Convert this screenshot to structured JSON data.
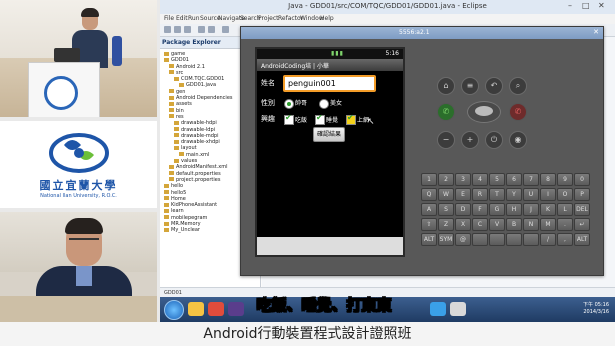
{
  "window": {
    "title": "Java - GDD01/src/COM/TQC/GDD01/GDD01.java - Eclipse",
    "controls": [
      "–",
      "□",
      "✕"
    ]
  },
  "menubar": {
    "items": [
      "File",
      "Edit",
      "Run",
      "Source",
      "Navigate",
      "Search",
      "Project",
      "Refactor",
      "Window",
      "Help"
    ]
  },
  "package_explorer": {
    "title": "Package Explorer",
    "tree": [
      "game",
      "GDD01",
      "Android 2.1",
      "src",
      "COM.TQC.GDD01",
      "GDD01.java",
      "gen",
      "Android Dependencies",
      "assets",
      "bin",
      "res",
      "drawable-hdpi",
      "drawable-ldpi",
      "drawable-mdpi",
      "drawable-xhdpi",
      "layout",
      "main.xml",
      "values",
      "AndroidManifest.xml",
      "default.properties",
      "project.properties",
      "hello",
      "hello5",
      "Home",
      "KidPhoneAssistant",
      "learn",
      "mobilepegram",
      "MR.Memory",
      "My_Unclear",
      "GDD01"
    ]
  },
  "emulator": {
    "title": "5556:a2.1",
    "status_time": "5:16",
    "app_title": "AndroidCoding培 | 小華",
    "name_label": "姓名",
    "name_value": "penguin001",
    "gender_label": "性別",
    "gender_options": [
      {
        "label": "帥哥",
        "selected": true
      },
      {
        "label": "美女",
        "selected": false
      }
    ],
    "hobby_label": "興趣",
    "hobbies": [
      {
        "label": "吃飯",
        "checked": true,
        "highlight": false
      },
      {
        "label": "睡覺",
        "checked": true,
        "highlight": false
      },
      {
        "label": "上網",
        "checked": true,
        "highlight": true
      }
    ],
    "confirm_button": "確認結果",
    "keyboard_rows": [
      [
        "1",
        "2",
        "3",
        "4",
        "5",
        "6",
        "7",
        "8",
        "9",
        "0"
      ],
      [
        "Q",
        "W",
        "E",
        "R",
        "T",
        "Y",
        "U",
        "I",
        "O",
        "P"
      ],
      [
        "A",
        "S",
        "D",
        "F",
        "G",
        "H",
        "J",
        "K",
        "L",
        "DEL"
      ],
      [
        "⇧",
        "Z",
        "X",
        "C",
        "V",
        "B",
        "N",
        "M",
        ".",
        "↵"
      ],
      [
        "ALT",
        "SYM",
        "@",
        "",
        "",
        "",
        "",
        "/",
        ",",
        "ALT"
      ]
    ]
  },
  "branding": {
    "university_name": "國立宜蘭大學",
    "university_en": "National Ilan University, R.O.C."
  },
  "taskbar": {
    "clock_time": "下午 05:16",
    "clock_date": "2014/3/16"
  },
  "subtitle": "吃飯、睡覺、打東東",
  "caption": "Android行動裝置程式設計證照班",
  "colors": {
    "accent": "#f39c28",
    "check": "#2e9d2e",
    "brand": "#1e55a8"
  }
}
